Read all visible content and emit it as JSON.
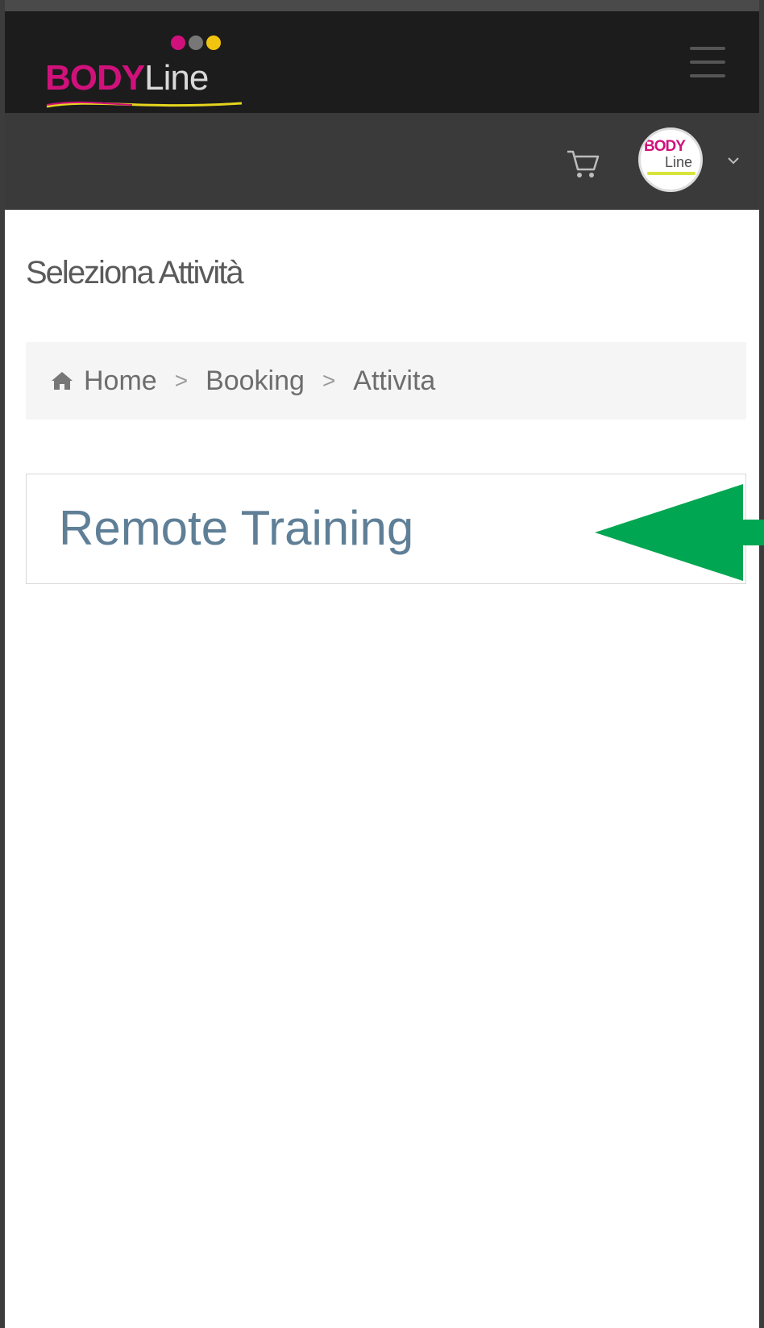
{
  "brand": {
    "name_part1": "BODY",
    "name_part2": "Line",
    "dot_colors": [
      "#d1117b",
      "#777777",
      "#f1c40f"
    ],
    "accent": "#d1117b"
  },
  "header": {
    "menu_icon": "hamburger-icon",
    "cart_icon": "cart-icon",
    "avatar": {
      "line1": "BODY",
      "line2": "Line"
    },
    "dropdown_icon": "chevron-down-icon"
  },
  "page": {
    "title": "Seleziona Attività"
  },
  "breadcrumb": {
    "home_icon": "home-icon",
    "items": [
      "Home",
      "Booking",
      "Attivita"
    ],
    "separator": ">"
  },
  "activities": [
    {
      "name": "Remote Training"
    }
  ],
  "annotation": {
    "arrow_color": "#00a651"
  }
}
